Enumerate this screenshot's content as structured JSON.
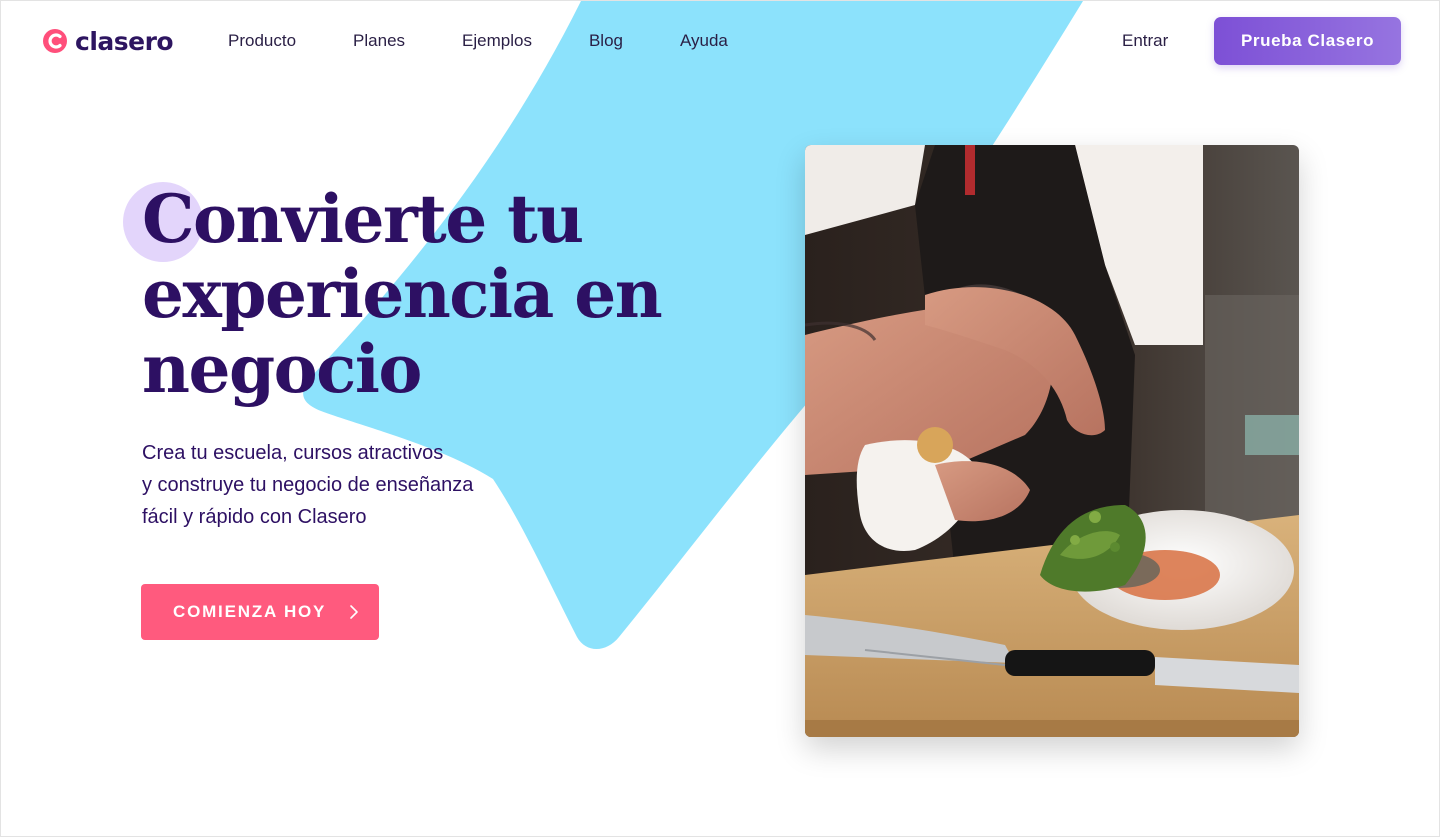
{
  "brand": {
    "name": "clasero",
    "logo_icon": "clasero-logo-icon",
    "colors": {
      "primary_text": "#2d1063",
      "accent_pink": "#ff5a7e",
      "accent_purple": "#7d50d6",
      "shape_blue": "#8ce2fc",
      "dot_lavender": "#e3d5fb"
    }
  },
  "header": {
    "nav": [
      {
        "label": "Producto"
      },
      {
        "label": "Planes"
      },
      {
        "label": "Ejemplos"
      },
      {
        "label": "Blog"
      },
      {
        "label": "Ayuda"
      }
    ],
    "login_label": "Entrar",
    "cta_label": "Prueba Clasero"
  },
  "hero": {
    "title_lines": [
      "Convierte tu",
      "experiencia en",
      "negocio"
    ],
    "subtitle_lines": [
      "Crea tu escuela, cursos atractivos",
      "y construye tu negocio de enseñanza",
      "fácil y rápido con Clasero"
    ],
    "cta_label": "COMIENZA HOY",
    "cta_icon": "chevron-right-icon",
    "image": "chef-plating-photo"
  }
}
